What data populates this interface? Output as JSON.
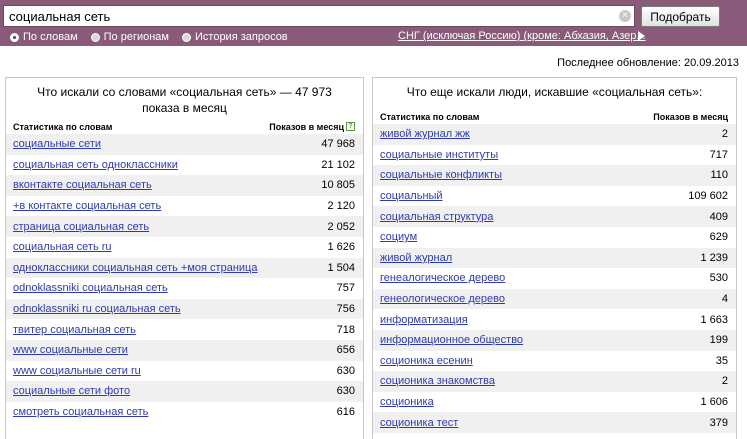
{
  "search": {
    "value": "социальная сеть",
    "button_label": "Подобрать",
    "clear_glyph": "×"
  },
  "radios": [
    {
      "label": "По словам",
      "checked": true
    },
    {
      "label": "По регионам",
      "checked": false
    },
    {
      "label": "История запросов",
      "checked": false
    }
  ],
  "region": {
    "label": "СНГ (исключая Россию) (кроме: Абхазия, Азер..."
  },
  "updated": "Последнее обновление: 20.09.2013",
  "left_panel": {
    "title": "Что искали со словами «социальная сеть» — 47 973 показа в месяц",
    "col_phrase": "Статистика по словам",
    "col_count": "Показов в месяц",
    "help_glyph": "?",
    "rows": [
      {
        "phrase": "социальные сети",
        "count": "47 968"
      },
      {
        "phrase": "социальная сеть одноклассники",
        "count": "21 102"
      },
      {
        "phrase": "вконтакте социальная сеть",
        "count": "10 805"
      },
      {
        "phrase": "+в контакте социальная сеть",
        "count": "2 120"
      },
      {
        "phrase": "страница социальная сеть",
        "count": "2 052"
      },
      {
        "phrase": "социальная сеть ru",
        "count": "1 626"
      },
      {
        "phrase": "одноклассники социальная сеть +моя страница",
        "count": "1 504"
      },
      {
        "phrase": "odnoklassniki социальная сеть",
        "count": "757"
      },
      {
        "phrase": "odnoklassniki ru социальная сеть",
        "count": "756"
      },
      {
        "phrase": "твитер социальная сеть",
        "count": "718"
      },
      {
        "phrase": "www социальные сети",
        "count": "656"
      },
      {
        "phrase": "www социальные сети ru",
        "count": "630"
      },
      {
        "phrase": "социальные сети фото",
        "count": "630"
      },
      {
        "phrase": "смотреть социальная сеть",
        "count": "616"
      }
    ]
  },
  "right_panel": {
    "title": "Что еще искали люди, искавшие «социальная сеть»:",
    "col_phrase": "Статистика по словам",
    "col_count": "Показов в месяц",
    "rows": [
      {
        "phrase": "живой журнал жж",
        "count": "2"
      },
      {
        "phrase": "социальные институты",
        "count": "717"
      },
      {
        "phrase": "социальные конфликты",
        "count": "110"
      },
      {
        "phrase": "социальный",
        "count": "109 602"
      },
      {
        "phrase": "социальная структура",
        "count": "409"
      },
      {
        "phrase": "социум",
        "count": "629"
      },
      {
        "phrase": "живой журнал",
        "count": "1 239"
      },
      {
        "phrase": "генеалогическое дерево",
        "count": "530"
      },
      {
        "phrase": "генеологическое дерево",
        "count": "4"
      },
      {
        "phrase": "информатизация",
        "count": "1 663"
      },
      {
        "phrase": "информационное общество",
        "count": "199"
      },
      {
        "phrase": "соционика есенин",
        "count": "35"
      },
      {
        "phrase": "соционика знакомства",
        "count": "2"
      },
      {
        "phrase": "соционика",
        "count": "1 606"
      },
      {
        "phrase": "соционика тест",
        "count": "379"
      }
    ]
  }
}
